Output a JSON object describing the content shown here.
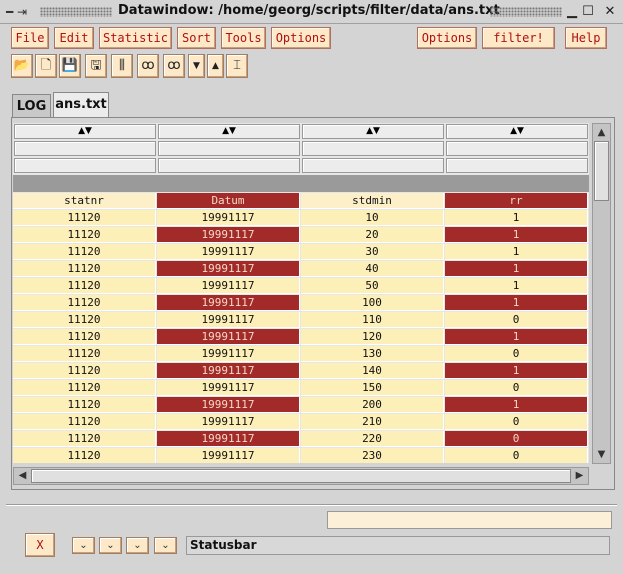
{
  "window": {
    "title": "Datawindow: /home/georg/scripts/filter/data/ans.txt",
    "left_glyph": "━ ⇥",
    "minimize_glyph": "▁",
    "maximize_glyph": "☐",
    "close_glyph": "✕"
  },
  "menu": {
    "file": "File",
    "edit": "Edit",
    "statistic": "Statistic",
    "sort": "Sort",
    "tools": "Tools",
    "options": "Options",
    "options2": "Options",
    "filter": "filter!",
    "help": "Help"
  },
  "toolbar": {
    "icons": [
      "folder-open-icon",
      "new-file-icon",
      "save-icon",
      "save-as-icon",
      "columns-icon",
      "glasses-icon",
      "glasses-alt-icon",
      "arrow-down-icon",
      "arrow-up-icon",
      "merge-icon"
    ],
    "glyphs": [
      "📂",
      "🗋",
      "💾",
      "🖫",
      "⫼",
      "ꝏ",
      "ꝏ",
      "▼",
      "▲",
      "⌶"
    ]
  },
  "tabs": {
    "log": "LOG",
    "ans": "ans.txt"
  },
  "sort_arrow": "▲▼",
  "columns": [
    "statnr",
    "Datum",
    "stdmin",
    "rr"
  ],
  "rows": [
    [
      "11120",
      "19991117",
      "10",
      "1"
    ],
    [
      "11120",
      "19991117",
      "20",
      "1"
    ],
    [
      "11120",
      "19991117",
      "30",
      "1"
    ],
    [
      "11120",
      "19991117",
      "40",
      "1"
    ],
    [
      "11120",
      "19991117",
      "50",
      "1"
    ],
    [
      "11120",
      "19991117",
      "100",
      "1"
    ],
    [
      "11120",
      "19991117",
      "110",
      "0"
    ],
    [
      "11120",
      "19991117",
      "120",
      "1"
    ],
    [
      "11120",
      "19991117",
      "130",
      "0"
    ],
    [
      "11120",
      "19991117",
      "140",
      "1"
    ],
    [
      "11120",
      "19991117",
      "150",
      "0"
    ],
    [
      "11120",
      "19991117",
      "200",
      "1"
    ],
    [
      "11120",
      "19991117",
      "210",
      "0"
    ],
    [
      "11120",
      "19991117",
      "220",
      "0"
    ],
    [
      "11120",
      "19991117",
      "230",
      "0"
    ]
  ],
  "scroll": {
    "up": "▲",
    "down": "▼",
    "left": "◀",
    "right": "▶"
  },
  "bottom": {
    "close_label": "X",
    "nav_glyph": "⌄",
    "statusbar": "Statusbar",
    "entry_value": ""
  },
  "colors": {
    "accent_red": "#a22a28",
    "cell_light": "#fdefb8",
    "button_bg": "#fde9c8"
  }
}
